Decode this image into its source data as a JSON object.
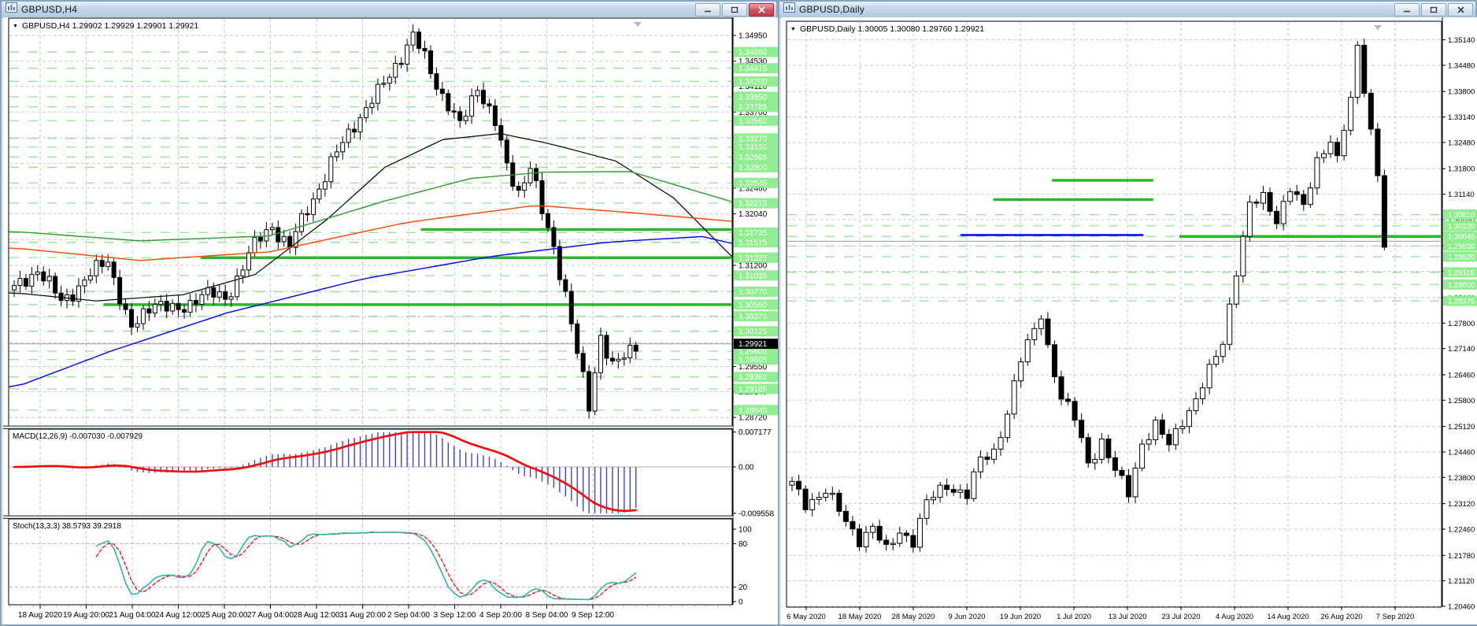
{
  "colors": {
    "grid": "#c9c9c9",
    "level_green": "#8fe88f",
    "sr_green": "#2db52d",
    "blue_line": "#0000ff",
    "candle_up": "#ffffff",
    "candle_down": "#000000",
    "candle_stroke": "#000000",
    "ma_black": "#000000",
    "ma_green": "#2e9b2e",
    "ma_orange": "#ff4500",
    "ma_blue": "#0000ff",
    "macd_hist": "#4343c8",
    "macd_signal": "#ff0000",
    "stoch_main": "#20b2aa",
    "stoch_signal": "#ff0000",
    "bid_line": "#9a9a9a",
    "label_green_bg": "#90ee90",
    "label_green_text": "#ffffff",
    "bid_box_bg": "#000000",
    "bid_box_text": "#ffffff"
  },
  "left_window": {
    "title": "GBPUSD,H4",
    "active": true,
    "info_line": {
      "arrow": "▼",
      "symbol": "GBPUSD,H4",
      "ohlc": "1.29902 1.29929 1.29901 1.29921"
    },
    "chart": {
      "price_top": 1.3522,
      "price_bottom": 1.2858,
      "axis_ticks": [
        1.3495,
        1.3453,
        1.3412,
        1.337,
        1.3328,
        1.3286,
        1.3246,
        1.3204,
        1.3162,
        1.312,
        1.3078,
        1.3036,
        1.2994,
        1.2955,
        1.2914,
        1.2872
      ],
      "level_lines": [
        1.3468,
        1.34415,
        1.342,
        1.3395,
        1.33785,
        1.3356,
        1.3327,
        1.3313,
        1.32965,
        1.328,
        1.32545,
        1.32215,
        1.31735,
        1.31575,
        1.31325,
        1.31035,
        1.3077,
        1.3056,
        1.3037,
        1.30125,
        1.298,
        1.29665,
        1.2938,
        1.29185,
        1.2884
      ],
      "sr_lines": [
        {
          "price": 1.31785,
          "from": 0.57,
          "to": 1.0
        },
        {
          "price": 1.31325,
          "from": 0.265,
          "to": 1.0
        },
        {
          "price": 1.3056,
          "from": 0.13,
          "to": 1.0
        }
      ],
      "bid": 1.29921,
      "time_labels": [
        "18 Aug 2020",
        "19 Aug 20:00",
        "21 Aug 04:00",
        "24 Aug 12:00",
        "25 Aug 20:00",
        "27 Aug 04:00",
        "28 Aug 12:00",
        "31 Aug 20:00",
        "2 Sep 04:00",
        "3 Sep 12:00",
        "4 Sep 20:00",
        "8 Sep 04:00",
        "9 Sep 12:00"
      ],
      "candles": {
        "count": 107,
        "amp": 0.0016,
        "anchors": [
          [
            0,
            1.308
          ],
          [
            4,
            1.3115
          ],
          [
            8,
            1.306
          ],
          [
            12,
            1.3095
          ],
          [
            16,
            1.313
          ],
          [
            20,
            1.3012
          ],
          [
            24,
            1.3065
          ],
          [
            28,
            1.304
          ],
          [
            32,
            1.3078
          ],
          [
            36,
            1.3062
          ],
          [
            40,
            1.314
          ],
          [
            44,
            1.3185
          ],
          [
            47,
            1.315
          ],
          [
            50,
            1.3212
          ],
          [
            54,
            1.3285
          ],
          [
            58,
            1.3352
          ],
          [
            62,
            1.34
          ],
          [
            65,
            1.3448
          ],
          [
            68,
            1.3492
          ],
          [
            70,
            1.3458
          ],
          [
            73,
            1.3398
          ],
          [
            76,
            1.3345
          ],
          [
            79,
            1.3415
          ],
          [
            82,
            1.335
          ],
          [
            84,
            1.328
          ],
          [
            86,
            1.3242
          ],
          [
            88,
            1.3282
          ],
          [
            90,
            1.3205
          ],
          [
            92,
            1.315
          ],
          [
            94,
            1.3075
          ],
          [
            96,
            1.2975
          ],
          [
            98,
            1.2888
          ],
          [
            100,
            1.3008
          ],
          [
            102,
            1.2955
          ],
          [
            104,
            1.2968
          ],
          [
            106,
            1.2992
          ]
        ]
      },
      "moving_averages": [
        {
          "name": "ma-black",
          "color": "ma_black",
          "width": 1.2,
          "anchors": [
            [
              0.01,
              1.3075
            ],
            [
              0.12,
              1.3062
            ],
            [
              0.24,
              1.3072
            ],
            [
              0.34,
              1.3105
            ],
            [
              0.44,
              1.3195
            ],
            [
              0.52,
              1.328
            ],
            [
              0.6,
              1.3325
            ],
            [
              0.68,
              1.3335
            ],
            [
              0.75,
              1.3318
            ],
            [
              0.84,
              1.329
            ],
            [
              0.92,
              1.323
            ],
            [
              1.0,
              1.3135
            ]
          ]
        },
        {
          "name": "ma-green",
          "color": "ma_green",
          "width": 1.4,
          "anchors": [
            [
              0.01,
              1.3175
            ],
            [
              0.18,
              1.316
            ],
            [
              0.36,
              1.3168
            ],
            [
              0.52,
              1.3225
            ],
            [
              0.64,
              1.3262
            ],
            [
              0.74,
              1.3272
            ],
            [
              0.86,
              1.3273
            ],
            [
              1.0,
              1.3224
            ]
          ]
        },
        {
          "name": "ma-orange",
          "color": "ma_orange",
          "width": 1.4,
          "anchors": [
            [
              0.01,
              1.3148
            ],
            [
              0.18,
              1.3128
            ],
            [
              0.36,
              1.3142
            ],
            [
              0.55,
              1.319
            ],
            [
              0.73,
              1.3218
            ],
            [
              0.86,
              1.3206
            ],
            [
              1.0,
              1.3192
            ]
          ]
        },
        {
          "name": "ma-blue",
          "color": "ma_blue",
          "width": 1.4,
          "anchors": [
            [
              0.01,
              1.2922
            ],
            [
              0.14,
              1.298
            ],
            [
              0.3,
              1.3042
            ],
            [
              0.49,
              1.3098
            ],
            [
              0.67,
              1.3135
            ],
            [
              0.83,
              1.3158
            ],
            [
              0.96,
              1.3167
            ],
            [
              1.0,
              1.3156
            ]
          ]
        }
      ]
    },
    "macd": {
      "label": "MACD(12,26,9)",
      "values": "-0.007030 -0.007929",
      "scale_max_label": "0.007177",
      "scale_zero_label": "0.00",
      "scale_min_label": "-0.009558",
      "scale_max": 0.007177,
      "scale_min": -0.009558,
      "params": [
        12,
        26,
        9
      ]
    },
    "stoch": {
      "label": "Stoch(13,3,3)",
      "values": "38.5793 39.2918",
      "scale_labels": [
        "100",
        "80",
        "20",
        "0"
      ],
      "scale_values": [
        100,
        80,
        20,
        0
      ],
      "params": [
        13,
        3,
        3
      ]
    }
  },
  "right_window": {
    "title": "GBPUSD,Daily",
    "active": false,
    "info_line": {
      "arrow": "▼",
      "symbol": "GBPUSD,Daily",
      "ohlc": "1.30005 1.30080 1.29760 1.29921"
    },
    "chart": {
      "price_top": 1.356,
      "price_bottom": 1.2046,
      "axis_ticks": [
        1.3514,
        1.3448,
        1.338,
        1.3314,
        1.3248,
        1.318,
        1.3114,
        1.3048,
        1.298,
        1.2914,
        1.2846,
        1.278,
        1.2714,
        1.2646,
        1.258,
        1.2512,
        1.2446,
        1.238,
        1.2312,
        1.2246,
        1.2178,
        1.2112,
        1.2046
      ],
      "level_lines": [
        1.3061,
        1.3032,
        1.30045,
        1.298,
        1.2952,
        1.29115,
        1.288,
        1.28375
      ],
      "sr_lines": [
        {
          "price": 1.315,
          "from": 0.405,
          "to": 0.56
        },
        {
          "price": 1.31,
          "from": 0.315,
          "to": 0.56
        },
        {
          "price": 1.30045,
          "from": 0.6,
          "to": 1.0
        }
      ],
      "blue_line": {
        "price": 1.3008,
        "from": 0.265,
        "to": 0.545
      },
      "bid": 1.29921,
      "time_labels": [
        "6 May 2020",
        "18 May 2020",
        "28 May 2020",
        "9 Jun 2020",
        "19 Jun 2020",
        "1 Jul 2020",
        "13 Jul 2020",
        "23 Jul 2020",
        "4 Aug 2020",
        "14 Aug 2020",
        "26 Aug 2020",
        "7 Sep 2020"
      ],
      "candles": {
        "count": 89,
        "amp": 0.0022,
        "anchors": [
          [
            0,
            1.236
          ],
          [
            2,
            1.2312
          ],
          [
            5,
            1.2348
          ],
          [
            8,
            1.2262
          ],
          [
            10,
            1.2222
          ],
          [
            12,
            1.2252
          ],
          [
            14,
            1.2185
          ],
          [
            16,
            1.2242
          ],
          [
            18,
            1.2218
          ],
          [
            20,
            1.2312
          ],
          [
            23,
            1.2362
          ],
          [
            26,
            1.2335
          ],
          [
            28,
            1.2422
          ],
          [
            30,
            1.2448
          ],
          [
            32,
            1.2552
          ],
          [
            34,
            1.2682
          ],
          [
            36,
            1.2762
          ],
          [
            37,
            1.2808
          ],
          [
            38,
            1.2722
          ],
          [
            40,
            1.2582
          ],
          [
            42,
            1.2532
          ],
          [
            44,
            1.2422
          ],
          [
            46,
            1.2472
          ],
          [
            48,
            1.2392
          ],
          [
            50,
            1.2342
          ],
          [
            52,
            1.2472
          ],
          [
            54,
            1.2512
          ],
          [
            56,
            1.2462
          ],
          [
            58,
            1.2532
          ],
          [
            60,
            1.2582
          ],
          [
            62,
            1.2652
          ],
          [
            64,
            1.2732
          ],
          [
            66,
            1.2922
          ],
          [
            68,
            1.3082
          ],
          [
            70,
            1.3102
          ],
          [
            72,
            1.3052
          ],
          [
            74,
            1.3132
          ],
          [
            76,
            1.3072
          ],
          [
            78,
            1.3202
          ],
          [
            80,
            1.3262
          ],
          [
            81,
            1.3202
          ],
          [
            82,
            1.3282
          ],
          [
            83,
            1.3352
          ],
          [
            84,
            1.349
          ],
          [
            85,
            1.3392
          ],
          [
            86,
            1.3282
          ],
          [
            87,
            1.3172
          ],
          [
            88,
            1.2982
          ]
        ]
      }
    }
  },
  "chart_data": [
    {
      "type": "candlestick-with-indicators",
      "title": "GBPUSD,H4",
      "y_axis_range": [
        1.2858,
        1.3522
      ],
      "x_labels": [
        "18 Aug 2020",
        "19 Aug 20:00",
        "21 Aug 04:00",
        "24 Aug 12:00",
        "25 Aug 20:00",
        "27 Aug 04:00",
        "28 Aug 12:00",
        "31 Aug 20:00",
        "2 Sep 04:00",
        "3 Sep 12:00",
        "4 Sep 20:00",
        "8 Sep 04:00",
        "9 Sep 12:00"
      ],
      "last_quote": {
        "open": 1.29902,
        "high": 1.29929,
        "low": 1.29901,
        "close": 1.29921
      },
      "indicators": [
        "MACD(12,26,9) = -0.007030 / -0.007929",
        "Stoch(13,3,3) = 38.5793 / 39.2918"
      ]
    },
    {
      "type": "candlestick",
      "title": "GBPUSD,Daily",
      "y_axis_range": [
        1.2046,
        1.356
      ],
      "x_labels": [
        "6 May 2020",
        "18 May 2020",
        "28 May 2020",
        "9 Jun 2020",
        "19 Jun 2020",
        "1 Jul 2020",
        "13 Jul 2020",
        "23 Jul 2020",
        "4 Aug 2020",
        "14 Aug 2020",
        "26 Aug 2020",
        "7 Sep 2020"
      ],
      "last_quote": {
        "open": 1.30005,
        "high": 1.3008,
        "low": 1.2976,
        "close": 1.29921
      }
    }
  ]
}
